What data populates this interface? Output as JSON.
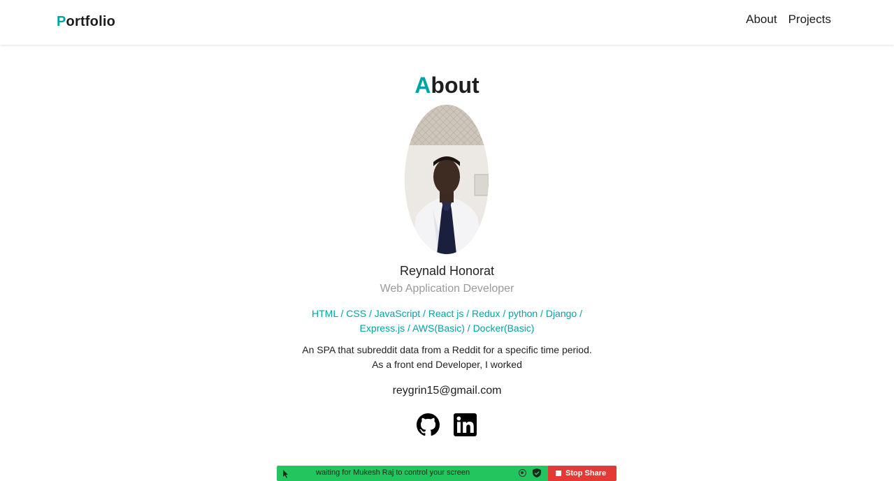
{
  "navbar": {
    "brand_initial": "P",
    "brand_rest": "ortfolio",
    "links": [
      {
        "label": "About"
      },
      {
        "label": "Projects"
      }
    ]
  },
  "about": {
    "heading_initial": "A",
    "heading_rest": "bout",
    "name": "Reynald Honorat",
    "role": "Web Application Developer",
    "skills": "HTML / CSS / JavaScript / React js / Redux / python / Django / Express.js / AWS(Basic) / Docker(Basic)",
    "description": "An SPA that subreddit data from a Reddit for a specific time period. As a front end Developer, I worked",
    "email": "reygrin15@gmail.com",
    "social_icons": [
      "github-icon",
      "linkedin-icon"
    ]
  },
  "share_bar": {
    "message": "waiting for Mukesh Raj to control your screen",
    "stop_label": "Stop Share"
  },
  "colors": {
    "accent": "#00a3a3",
    "share_green": "#22c55e",
    "stop_red": "#e53935"
  }
}
